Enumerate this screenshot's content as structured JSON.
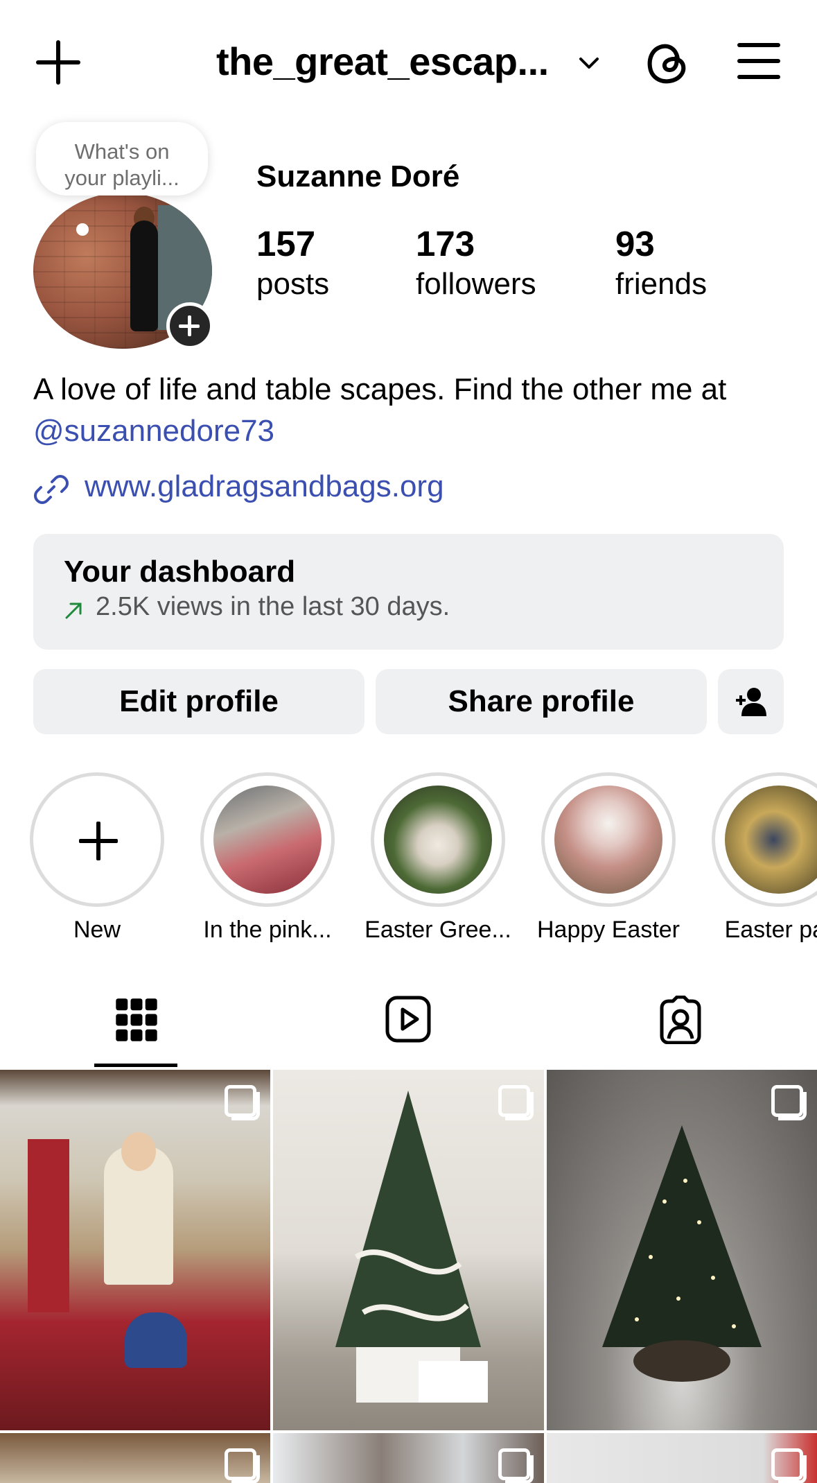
{
  "header": {
    "username": "the_great_escap...",
    "icons": [
      "plus-icon",
      "chevron-down-icon",
      "threads-icon",
      "menu-icon"
    ]
  },
  "profile": {
    "note_line1": "What's on",
    "note_line2": "your playli...",
    "full_name": "Suzanne Doré",
    "stats": [
      {
        "value": "157",
        "label": "posts"
      },
      {
        "value": "173",
        "label": "followers"
      },
      {
        "value": "93",
        "label": "friends"
      }
    ],
    "bio_text": "A love of life and table scapes. Find the other me at ",
    "bio_mention": "@suzannedore73",
    "website": "www.gladragsandbags.org"
  },
  "dashboard": {
    "title": "Your dashboard",
    "subtitle": "2.5K views in the last 30 days.",
    "accent": "#1f8a3b"
  },
  "actions": {
    "edit": "Edit profile",
    "share": "Share profile",
    "discover_icon": "add-person-icon"
  },
  "highlights": [
    {
      "label": "New"
    },
    {
      "label": "In the pink..."
    },
    {
      "label": "Easter Gree..."
    },
    {
      "label": "Happy Easter"
    },
    {
      "label": "Easter par"
    }
  ],
  "tabs": [
    "grid-icon",
    "reels-icon",
    "tagged-icon"
  ],
  "colors": {
    "link": "#3a4fb0",
    "button_bg": "#eff0f2"
  }
}
